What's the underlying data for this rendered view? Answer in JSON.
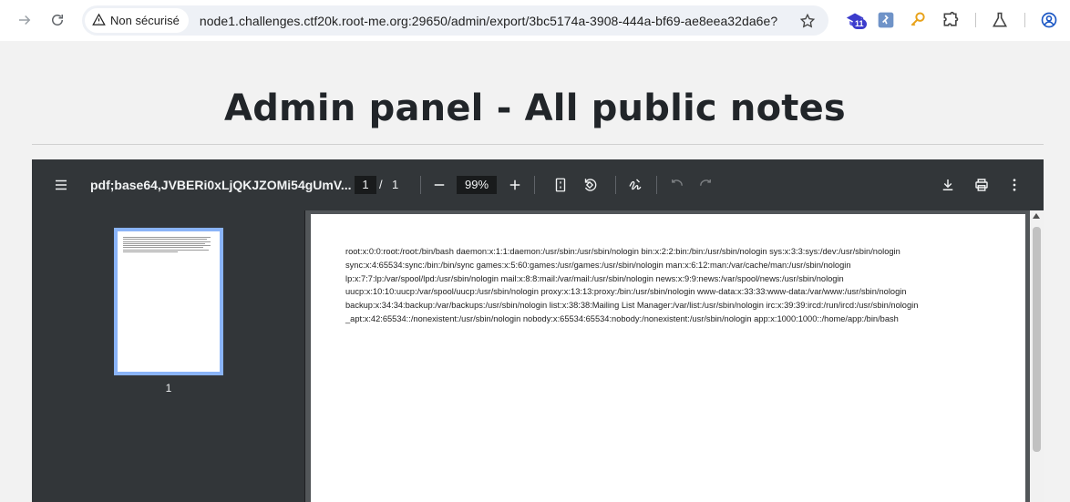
{
  "browser": {
    "security_label": "Non sécurisé",
    "url": "node1.challenges.ctf20k.root-me.org:29650/admin/export/3bc5174a-3908-444a-bf69-ae8eea32da6e?",
    "extension_badge": "11",
    "icons": [
      "forward-icon",
      "reload-icon",
      "warning-icon",
      "star-icon",
      "extension-icon",
      "profile-icon"
    ]
  },
  "page": {
    "title": "Admin panel - All public notes"
  },
  "pdf_viewer": {
    "document_name": "pdf;base64,JVBERi0xLjQKJZOMi54gUmV...",
    "current_page": "1",
    "page_separator": "/",
    "total_pages": "1",
    "zoom": "99%",
    "thumbnail_label": "1",
    "content_lines": [
      "root:x:0:0:root:/root:/bin/bash daemon:x:1:1:daemon:/usr/sbin:/usr/sbin/nologin bin:x:2:2:bin:/bin:/usr/sbin/nologin sys:x:3:3:sys:/dev:/usr/sbin/nologin",
      "sync:x:4:65534:sync:/bin:/bin/sync games:x:5:60:games:/usr/games:/usr/sbin/nologin man:x:6:12:man:/var/cache/man:/usr/sbin/nologin",
      "lp:x:7:7:lp:/var/spool/lpd:/usr/sbin/nologin mail:x:8:8:mail:/var/mail:/usr/sbin/nologin news:x:9:9:news:/var/spool/news:/usr/sbin/nologin",
      "uucp:x:10:10:uucp:/var/spool/uucp:/usr/sbin/nologin proxy:x:13:13:proxy:/bin:/usr/sbin/nologin www-data:x:33:33:www-data:/var/www:/usr/sbin/nologin",
      "backup:x:34:34:backup:/var/backups:/usr/sbin/nologin list:x:38:38:Mailing List Manager:/var/list:/usr/sbin/nologin irc:x:39:39:ircd:/run/ircd:/usr/sbin/nologin",
      "_apt:x:42:65534::/nonexistent:/usr/sbin/nologin nobody:x:65534:65534:nobody:/nonexistent:/usr/sbin/nologin app:x:1000:1000::/home/app:/bin/bash"
    ]
  }
}
